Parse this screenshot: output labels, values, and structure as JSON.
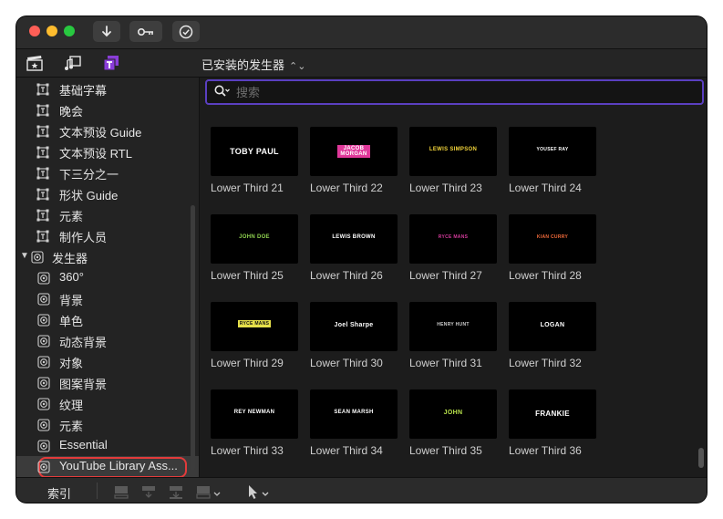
{
  "toolbar": {
    "icons": [
      "import-arrow-icon",
      "keyword-key-icon",
      "checkmark-circle-icon"
    ]
  },
  "browser_tabs": {
    "icons": [
      "clapper-star-icon",
      "music-photo-icon",
      "titles-generators-icon"
    ]
  },
  "header": {
    "title": "已安装的发生器",
    "chevron": "⌃⌄"
  },
  "search": {
    "placeholder": "搜索",
    "value": ""
  },
  "sidebar": {
    "title_items": [
      "基础字幕",
      "晚会",
      "文本预设 Guide",
      "文本预设 RTL",
      "下三分之一",
      "形状 Guide",
      "元素",
      "制作人员"
    ],
    "generators_parent": "发生器",
    "generator_items": [
      "360°",
      "背景",
      "单色",
      "动态背景",
      "对象",
      "图案背景",
      "纹理",
      "元素",
      "Essential",
      "YouTube Library Ass..."
    ]
  },
  "grid": {
    "tiles": [
      {
        "label": "Lower Third 21",
        "preview": "TOBY PAUL"
      },
      {
        "label": "Lower Third 22",
        "preview": "JACOB MORGAN"
      },
      {
        "label": "Lower Third 23",
        "preview": "LEWIS SIMPSON"
      },
      {
        "label": "Lower Third 24",
        "preview": "YOUSEF RAY"
      },
      {
        "label": "Lower Third 25",
        "preview": "JOHN DOE"
      },
      {
        "label": "Lower Third 26",
        "preview": "LEWIS BROWN"
      },
      {
        "label": "Lower Third 27",
        "preview": "RYCE MANS"
      },
      {
        "label": "Lower Third 28",
        "preview": "KIAN CURRY"
      },
      {
        "label": "Lower Third 29",
        "preview": "RYCE MANS"
      },
      {
        "label": "Lower Third 30",
        "preview": "Joel Sharpe"
      },
      {
        "label": "Lower Third 31",
        "preview": "HENRY HUNT"
      },
      {
        "label": "Lower Third 32",
        "preview": "LOGAN"
      },
      {
        "label": "Lower Third 33",
        "preview": "REY NEWMAN"
      },
      {
        "label": "Lower Third 34",
        "preview": "SEAN MARSH"
      },
      {
        "label": "Lower Third 35",
        "preview": "JOHN"
      },
      {
        "label": "Lower Third 36",
        "preview": "FRANKIE"
      }
    ]
  },
  "bottom": {
    "index_label": "索引"
  },
  "colors": {
    "accent": "#5a3fc0",
    "selection_ring": "#e23b3b",
    "tab_active": "#8a3dd8"
  }
}
